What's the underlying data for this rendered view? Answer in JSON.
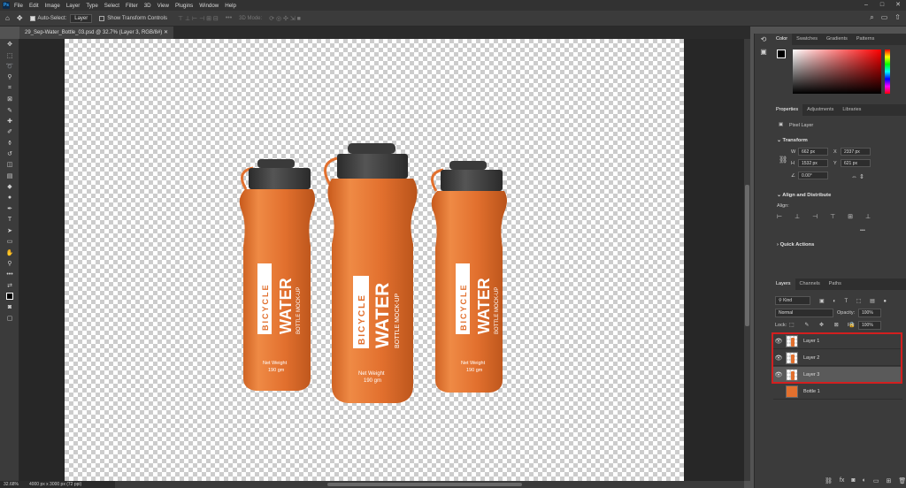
{
  "app": {
    "logo": "Ps",
    "menu": [
      "File",
      "Edit",
      "Image",
      "Layer",
      "Type",
      "Select",
      "Filter",
      "3D",
      "View",
      "Plugins",
      "Window",
      "Help"
    ],
    "window_controls": [
      "–",
      "□",
      "✕"
    ]
  },
  "options": {
    "auto_select_label": "Auto-Select:",
    "auto_select_value": "Layer",
    "transform_label": "Show Transform Controls",
    "mode_3d": "3D Mode:"
  },
  "document": {
    "tab_title": "29_Sep-Water_Bottle_03.psd @ 32.7% (Layer 3, RGB/8#)",
    "zoom": "32.68%",
    "size": "4000 px x 3000 px (72 ppi)"
  },
  "bottle": {
    "brand": "BICYCLE",
    "word": "WATER",
    "sub": "BOTTLE MOCK-UP",
    "net": "Net Weight",
    "gm": "190 gm",
    "colors": {
      "body": "#e2702e",
      "cap": "#3e3e3e",
      "label": "#ffffff"
    }
  },
  "color_panel": {
    "tabs": [
      "Color",
      "Swatches",
      "Gradients",
      "Patterns"
    ],
    "hue": "#ff0000"
  },
  "properties": {
    "tabs": [
      "Properties",
      "Adjustments",
      "Libraries"
    ],
    "type_label": "Pixel Layer",
    "transform_header": "Transform",
    "w_label": "W",
    "w_value": "662 px",
    "x_label": "X",
    "x_value": "2337 px",
    "h_label": "H",
    "h_value": "1532 px",
    "y_label": "Y",
    "y_value": "621 px",
    "angle_value": "0.00°",
    "align_header": "Align and Distribute",
    "align_label": "Align:",
    "quick_header": "Quick Actions"
  },
  "layers": {
    "tabs": [
      "Layers",
      "Channels",
      "Paths"
    ],
    "kind": "Kind",
    "blend": "Normal",
    "opacity_label": "Opacity:",
    "opacity_value": "100%",
    "lock_label": "Lock:",
    "fill_label": "Fill:",
    "fill_value": "100%",
    "items": [
      {
        "name": "Layer 1"
      },
      {
        "name": "Layer 2"
      },
      {
        "name": "Layer 3"
      },
      {
        "name": "Bottle 1"
      }
    ],
    "highlight": "#d21f1f"
  },
  "icons": {
    "eye": "eye-icon",
    "home": "home-icon",
    "move": "move-icon"
  }
}
